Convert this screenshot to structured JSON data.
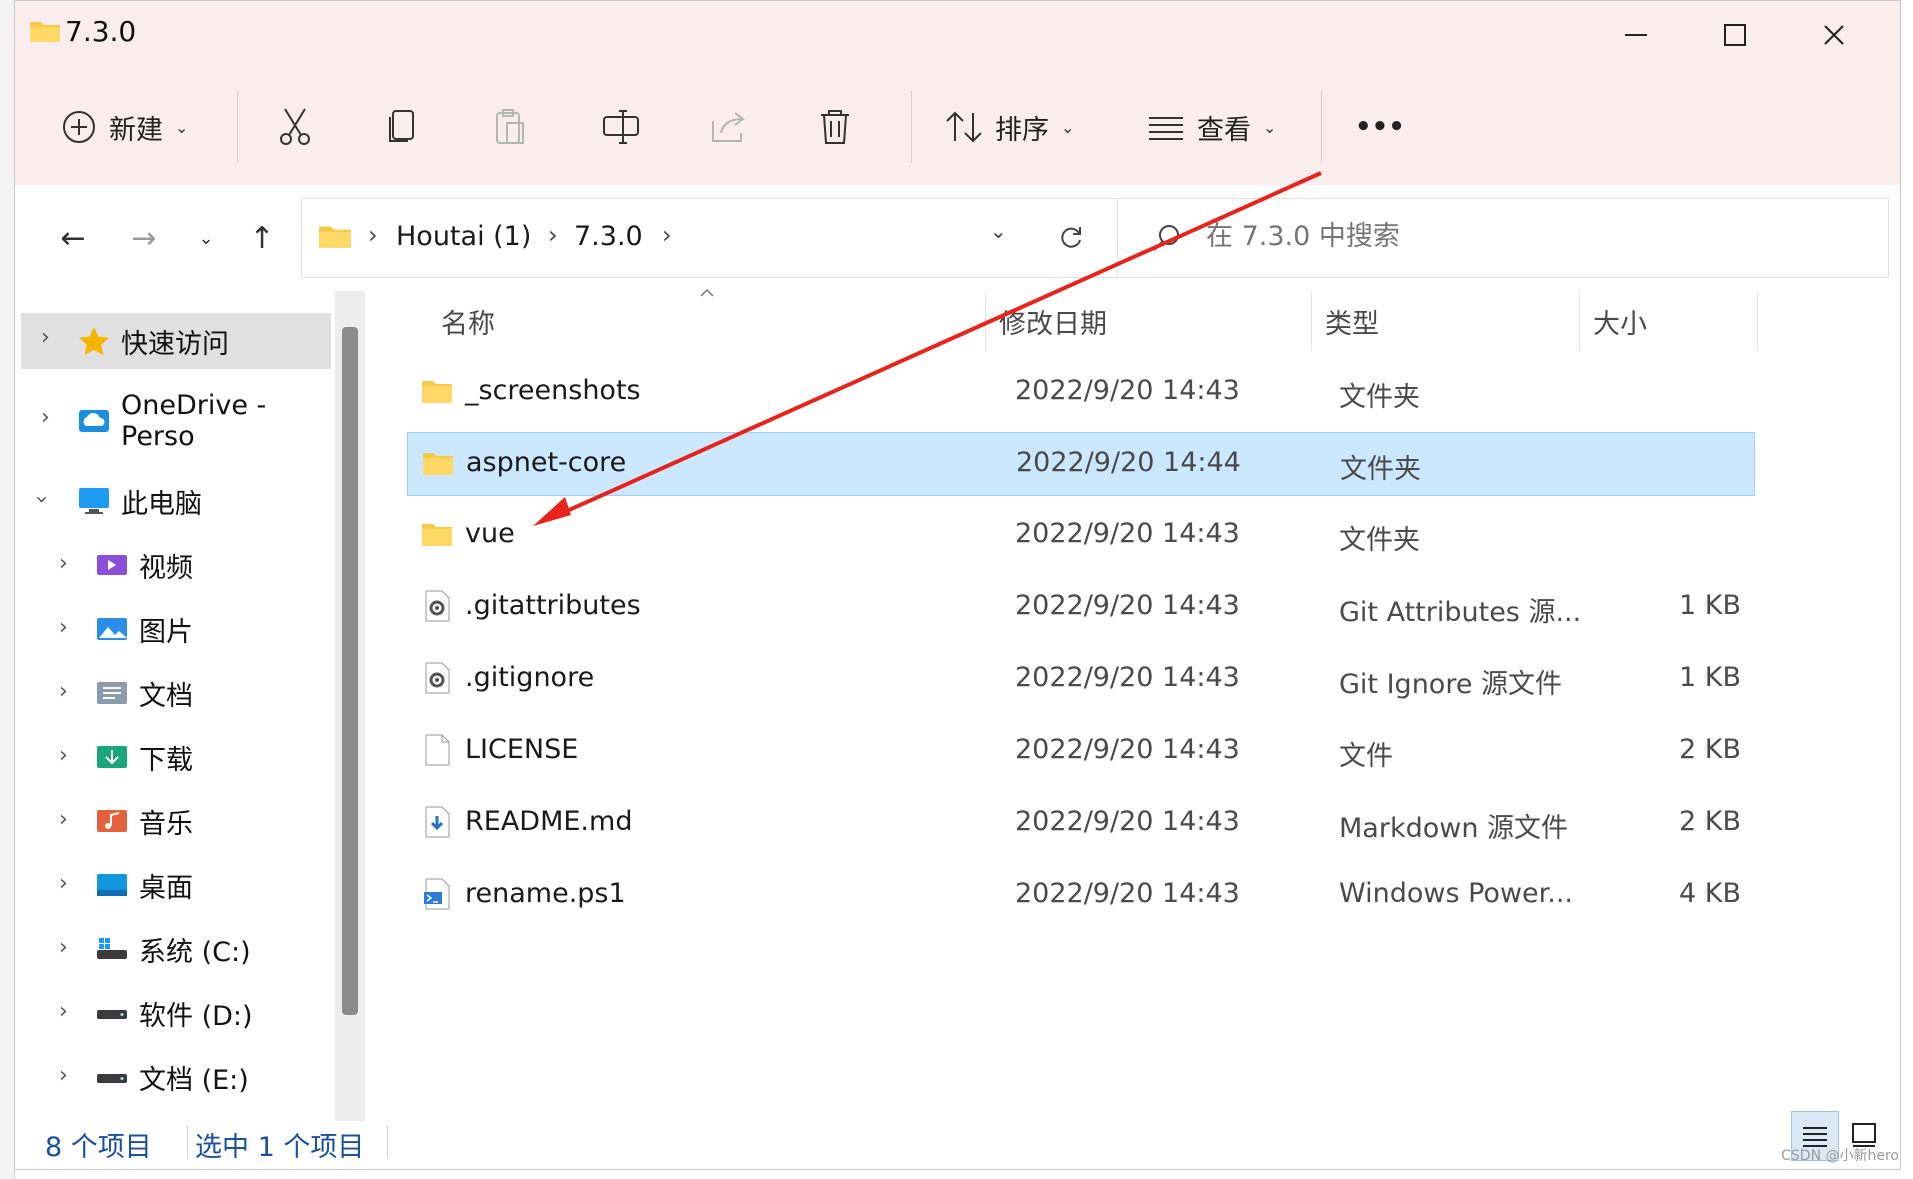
{
  "window": {
    "title": "7.3.0"
  },
  "toolbar": {
    "new_label": "新建",
    "sort_label": "排序",
    "view_label": "查看",
    "more_label": "•••"
  },
  "address": {
    "crumbs": [
      "Houtai (1)",
      "7.3.0"
    ]
  },
  "search": {
    "placeholder": "在 7.3.0 中搜索"
  },
  "sidebar": {
    "items": [
      {
        "label": "快速访问",
        "icon": "star-icon"
      },
      {
        "label": "OneDrive - Perso",
        "icon": "cloud-icon"
      },
      {
        "label": "此电脑",
        "icon": "computer-icon"
      },
      {
        "label": "视频",
        "icon": "video-icon"
      },
      {
        "label": "图片",
        "icon": "picture-icon"
      },
      {
        "label": "文档",
        "icon": "document-icon"
      },
      {
        "label": "下载",
        "icon": "download-icon"
      },
      {
        "label": "音乐",
        "icon": "music-icon"
      },
      {
        "label": "桌面",
        "icon": "desktop-icon"
      },
      {
        "label": "系统 (C:)",
        "icon": "drive-c-icon"
      },
      {
        "label": "软件 (D:)",
        "icon": "drive-icon"
      },
      {
        "label": "文档 (E:)",
        "icon": "drive-icon"
      }
    ]
  },
  "columns": {
    "name": "名称",
    "date": "修改日期",
    "type": "类型",
    "size": "大小"
  },
  "files": [
    {
      "name": "_screenshots",
      "date": "2022/9/20 14:43",
      "type": "文件夹",
      "size": "",
      "icon": "folder-icon"
    },
    {
      "name": "aspnet-core",
      "date": "2022/9/20 14:44",
      "type": "文件夹",
      "size": "",
      "icon": "folder-icon"
    },
    {
      "name": "vue",
      "date": "2022/9/20 14:43",
      "type": "文件夹",
      "size": "",
      "icon": "folder-icon"
    },
    {
      "name": ".gitattributes",
      "date": "2022/9/20 14:43",
      "type": "Git Attributes 源...",
      "size": "1 KB",
      "icon": "settings-file-icon"
    },
    {
      "name": ".gitignore",
      "date": "2022/9/20 14:43",
      "type": "Git Ignore 源文件",
      "size": "1 KB",
      "icon": "settings-file-icon"
    },
    {
      "name": "LICENSE",
      "date": "2022/9/20 14:43",
      "type": "文件",
      "size": "2 KB",
      "icon": "blank-file-icon"
    },
    {
      "name": "README.md",
      "date": "2022/9/20 14:43",
      "type": "Markdown 源文件",
      "size": "2 KB",
      "icon": "markdown-file-icon"
    },
    {
      "name": "rename.ps1",
      "date": "2022/9/20 14:43",
      "type": "Windows Power...",
      "size": "4 KB",
      "icon": "powershell-file-icon"
    }
  ],
  "status": {
    "count": "8 个项目",
    "selected": "选中 1 个项目"
  },
  "watermark": "CSDN @小新hero",
  "colors": {
    "selection": "#cce8ff",
    "toolbar_bg": "#f9eded",
    "arrow": "#e8231b"
  }
}
